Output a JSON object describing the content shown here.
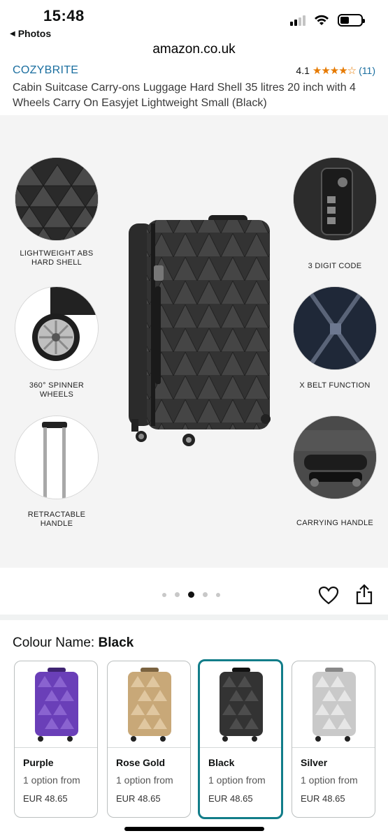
{
  "status_bar": {
    "time": "15:48",
    "back_label": "Photos",
    "icons": [
      "cellular-signal-icon",
      "wifi-icon",
      "battery-icon"
    ]
  },
  "browser": {
    "url": "amazon.co.uk"
  },
  "product": {
    "brand": "COZYBRITE",
    "rating_value": "4.1",
    "rating_stars": "★★★★☆",
    "rating_count": "(11)",
    "title": "Cabin Suitcase Carry-ons Luggage Hard Shell 35 litres 20 inch with 4 Wheels Carry On Easyjet Lightweight Small (Black)"
  },
  "gallery": {
    "features": {
      "abs": "LIGHTWEIGHT ABS HARD SHELL",
      "code": "3 DIGIT CODE",
      "wheels": "360° SPINNER WHEELS",
      "belt": "X BELT FUNCTION",
      "handle": "RETRACTABLE HANDLE",
      "carry": "CARRYING HANDLE"
    },
    "page_count": 5,
    "active_page": 3
  },
  "colour": {
    "label": "Colour Name:",
    "selected": "Black",
    "options": [
      {
        "name": "Purple",
        "availability": "1 option from",
        "price": "EUR 48.65",
        "color": "#6a3fb8"
      },
      {
        "name": "Rose Gold",
        "availability": "1 option from",
        "price": "EUR 48.65",
        "color": "#c8a878"
      },
      {
        "name": "Black",
        "availability": "1 option from",
        "price": "EUR 48.65",
        "color": "#333333"
      },
      {
        "name": "Silver",
        "availability": "1 option from",
        "price": "EUR 48.65",
        "color": "#c9c9c9"
      }
    ]
  },
  "colors": {
    "link": "#1a6e9f",
    "star": "#e67a00",
    "selected_border": "#127d89"
  }
}
